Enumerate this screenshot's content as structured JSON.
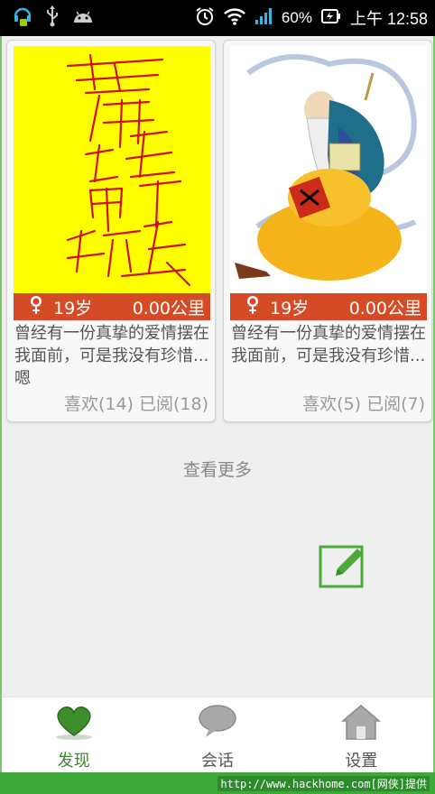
{
  "status_bar": {
    "battery": "60%",
    "time": "上午 12:58",
    "icons": [
      "headset-icon",
      "usb-icon",
      "android-icon",
      "alarm-icon",
      "wifi-icon",
      "signal-icon",
      "battery-icon"
    ]
  },
  "cards": [
    {
      "age": "19岁",
      "distance": "0.00公里",
      "description": "曾经有一份真挚的爱情摆在我面前，可是我没有珍惜...嗯",
      "stats": "喜欢(14) 已阅(18)",
      "image": "calligraphy-image"
    },
    {
      "age": "19岁",
      "distance": "0.00公里",
      "description": "曾经有一份真挚的爱情摆在我面前，可是我没有珍惜...",
      "stats": "喜欢(5) 已阅(7)",
      "image": "old-sage-image"
    }
  ],
  "load_more": "查看更多",
  "tabs": [
    {
      "label": "发现",
      "icon": "heart-icon",
      "active": true
    },
    {
      "label": "会话",
      "icon": "chat-bubble-icon",
      "active": false
    },
    {
      "label": "设置",
      "icon": "home-icon",
      "active": false
    }
  ],
  "footer": {
    "watermark": "http://www.hackhome.com[网侠]提供"
  },
  "colors": {
    "accent": "#3c8a2a",
    "info_bar": "#d54b25",
    "edit": "#4caa3d"
  }
}
